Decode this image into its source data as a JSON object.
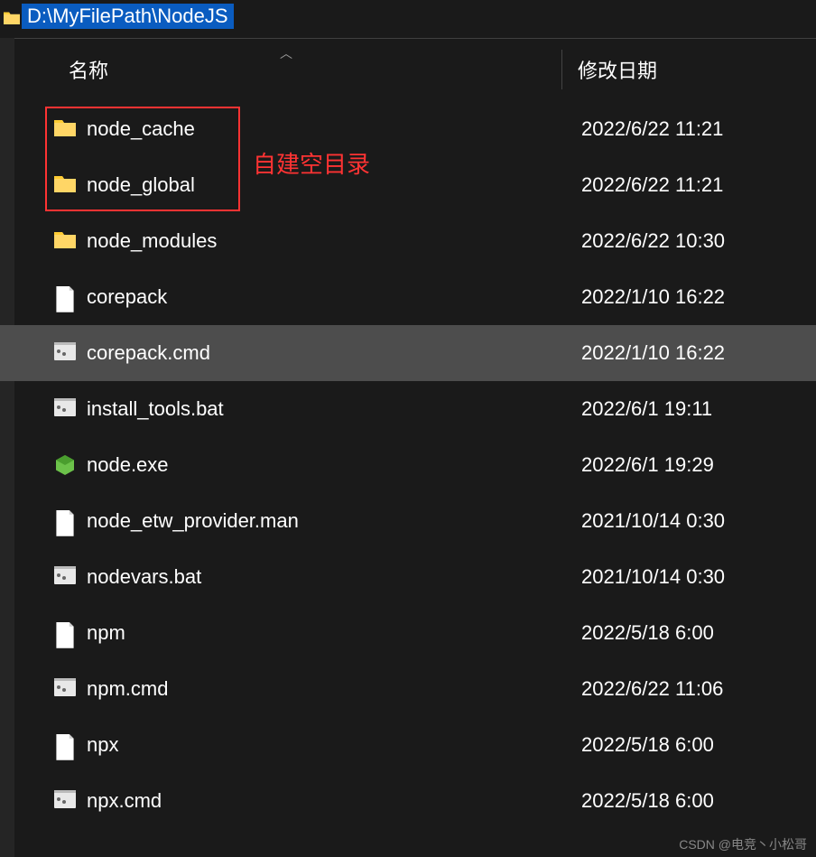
{
  "address": {
    "path": "D:\\MyFilePath\\NodeJS"
  },
  "columns": {
    "name": "名称",
    "date": "修改日期"
  },
  "annotation": {
    "label": "自建空目录"
  },
  "files": [
    {
      "name": "node_cache",
      "date": "2022/6/22 11:21",
      "icon": "folder",
      "selected": false
    },
    {
      "name": "node_global",
      "date": "2022/6/22 11:21",
      "icon": "folder",
      "selected": false
    },
    {
      "name": "node_modules",
      "date": "2022/6/22 10:30",
      "icon": "folder",
      "selected": false
    },
    {
      "name": "corepack",
      "date": "2022/1/10 16:22",
      "icon": "file",
      "selected": false
    },
    {
      "name": "corepack.cmd",
      "date": "2022/1/10 16:22",
      "icon": "cmd",
      "selected": true
    },
    {
      "name": "install_tools.bat",
      "date": "2022/6/1 19:11",
      "icon": "cmd",
      "selected": false
    },
    {
      "name": "node.exe",
      "date": "2022/6/1 19:29",
      "icon": "node",
      "selected": false
    },
    {
      "name": "node_etw_provider.man",
      "date": "2021/10/14 0:30",
      "icon": "file",
      "selected": false
    },
    {
      "name": "nodevars.bat",
      "date": "2021/10/14 0:30",
      "icon": "cmd",
      "selected": false
    },
    {
      "name": "npm",
      "date": "2022/5/18 6:00",
      "icon": "file",
      "selected": false
    },
    {
      "name": "npm.cmd",
      "date": "2022/6/22 11:06",
      "icon": "cmd",
      "selected": false
    },
    {
      "name": "npx",
      "date": "2022/5/18 6:00",
      "icon": "file",
      "selected": false
    },
    {
      "name": "npx.cmd",
      "date": "2022/5/18 6:00",
      "icon": "cmd",
      "selected": false
    }
  ],
  "watermark": "CSDN @电竞丶小松哥"
}
